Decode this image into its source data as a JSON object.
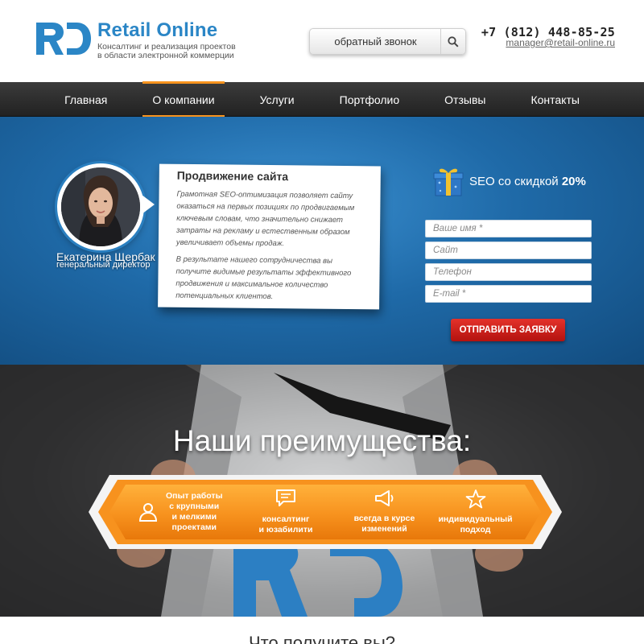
{
  "brand": {
    "title": "Retail Online",
    "subtitle_line1": "Консалтинг и реализация проектов",
    "subtitle_line2": "в области электронной коммерции",
    "colors": {
      "blue": "#2b86c6",
      "orange": "#f7931e",
      "red": "#d21d19"
    }
  },
  "header": {
    "callback_label": "обратный звонок",
    "search_icon": "search-icon",
    "phone": "+7 (812) 448-85-25",
    "email": "manager@retail-online.ru"
  },
  "nav": {
    "items": [
      {
        "label": "Главная",
        "active": false
      },
      {
        "label": "О компании",
        "active": true
      },
      {
        "label": "Услуги",
        "active": false
      },
      {
        "label": "Портфолио",
        "active": false
      },
      {
        "label": "Отзывы",
        "active": false
      },
      {
        "label": "Контакты",
        "active": false
      }
    ]
  },
  "hero": {
    "person_name": "Екатерина Щербак",
    "person_role": "генеральный директор",
    "card_title": "Продвижение сайта",
    "card_p1": "Грамотная SEO-оптимизация позволяет сайту оказаться на первых позициях по продвигаемым ключевым словам, что значительно снижает затраты на рекламу и естественным образом увеличивает объемы продаж.",
    "card_p2": "В результате нашего сотрудничества вы получите видимые результаты эффективного продвижения и максимальное количество потенциальных клиентов.",
    "promo_text": "SEO со скидкой ",
    "promo_discount": "20%",
    "form": {
      "name_placeholder": "Ваше имя *",
      "site_placeholder": "Сайт",
      "phone_placeholder": "Телефон",
      "email_placeholder": "E-mail *",
      "submit_label": "ОТПРАВИТЬ ЗАЯВКУ"
    }
  },
  "advantages": {
    "title": "Наши преимущества:",
    "items": [
      {
        "icon": "user-icon",
        "label_lines": [
          "Опыт работы",
          "с крупными",
          "и мелкими",
          "проектами"
        ]
      },
      {
        "icon": "chat-icon",
        "label_lines": [
          "консалтинг",
          "и юзабилити"
        ]
      },
      {
        "icon": "megaphone-icon",
        "label_lines": [
          "всегда в курсе",
          "изменений"
        ]
      },
      {
        "icon": "star-icon",
        "label_lines": [
          "индивидуальный",
          "подход"
        ]
      }
    ]
  },
  "next_section": {
    "heading": "Что получите вы?"
  }
}
